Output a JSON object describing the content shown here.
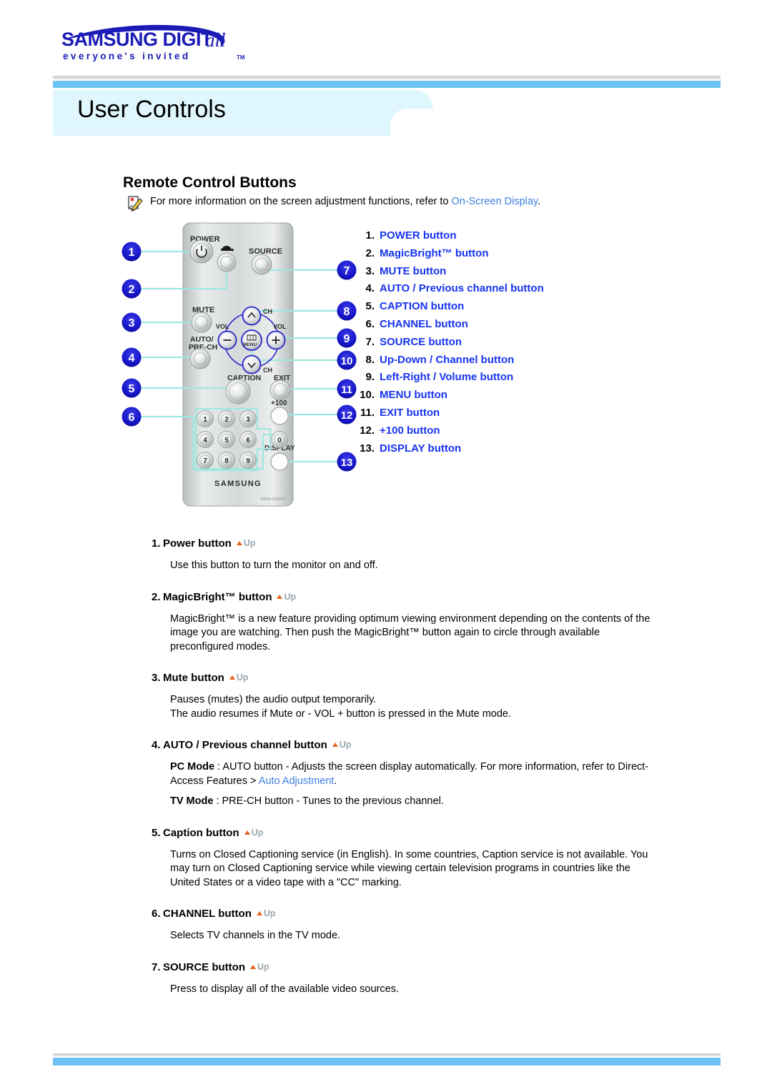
{
  "brand": {
    "logo_main": "SAMSUNG DIGITall",
    "logo_tagline": "everyone's invited",
    "logo_tm": "TM"
  },
  "header": {
    "page_title": "User Controls",
    "bar_color": "#6dc1f3",
    "band_color": "#dff7fc"
  },
  "section": {
    "title": "Remote Control Buttons",
    "note_prefix": "For more information on the screen adjustment functions, refer to ",
    "note_link": "On-Screen Display",
    "note_suffix": "."
  },
  "remote": {
    "labels": {
      "power": "POWER",
      "source": "SOURCE",
      "mute": "MUTE",
      "auto_prech_1": "AUTO/",
      "auto_prech_2": "PRE-CH",
      "caption": "CAPTION",
      "exit": "EXIT",
      "plus100": "+100",
      "display": "DISPLAY",
      "menu": "MENU",
      "vol_left": "VOL",
      "vol_right": "VOL",
      "ch_top": "CH",
      "ch_bottom": "CH",
      "brand": "SAMSUNG",
      "model_code": "BN68-00907D"
    },
    "keypad": [
      "1",
      "2",
      "3",
      "4",
      "5",
      "6",
      "7",
      "8",
      "9",
      "0"
    ],
    "callouts_left": [
      "1",
      "2",
      "3",
      "4",
      "5",
      "6"
    ],
    "callouts_right": [
      "7",
      "8",
      "9",
      "10",
      "11",
      "12",
      "13"
    ],
    "callout_color": "#1515d8",
    "leader_color": "#9fe8e0"
  },
  "legend": [
    {
      "n": "1.",
      "label": "POWER button"
    },
    {
      "n": "2.",
      "label": "MagicBright™ button"
    },
    {
      "n": "3.",
      "label": "MUTE button"
    },
    {
      "n": "4.",
      "label": "AUTO / Previous channel button"
    },
    {
      "n": "5.",
      "label": "CAPTION button"
    },
    {
      "n": "6.",
      "label": "CHANNEL button"
    },
    {
      "n": "7.",
      "label": "SOURCE button"
    },
    {
      "n": "8.",
      "label": "Up-Down / Channel button"
    },
    {
      "n": "9.",
      "label": "Left-Right / Volume button"
    },
    {
      "n": "10.",
      "label": "MENU button"
    },
    {
      "n": "11.",
      "label": "EXIT button"
    },
    {
      "n": "12.",
      "label": "+100 button"
    },
    {
      "n": "13.",
      "label": "DISPLAY button"
    }
  ],
  "up_label": "Up",
  "sections": [
    {
      "num": "1.",
      "title": "Power button",
      "p1": "Use this button to turn the monitor on and off."
    },
    {
      "num": "2.",
      "title": "MagicBright™ button",
      "p1": "MagicBright™ is a new feature providing optimum viewing environment depending on the contents of the image you are watching. Then push the MagicBright™ button again to circle through available preconfigured modes."
    },
    {
      "num": "3.",
      "title": "Mute button",
      "p1": "Pauses (mutes) the audio output temporarily.",
      "p2": "The audio resumes if Mute or - VOL + button is pressed in the Mute mode."
    },
    {
      "num": "4.",
      "title": "AUTO / Previous channel button",
      "pc_mode_label": "PC Mode",
      "pc_mode_text": " : AUTO button - Adjusts the screen display automatically. For more information, refer to Direct-Access Features > ",
      "pc_mode_link": "Auto Adjustment",
      "pc_mode_end": ".",
      "tv_mode_label": "TV Mode",
      "tv_mode_text": " : PRE-CH button - Tunes to the previous channel."
    },
    {
      "num": "5.",
      "title": "Caption button",
      "p1": "Turns on Closed Captioning service (in English). In some countries, Caption service is not available. You may turn on Closed Captioning service while viewing certain television programs in countries like the United States or a video tape with a \"CC\" marking."
    },
    {
      "num": "6.",
      "title": "CHANNEL button",
      "p1": "Selects TV channels in the TV mode."
    },
    {
      "num": "7.",
      "title": "SOURCE button",
      "p1": "Press to display all of the available video sources."
    }
  ]
}
